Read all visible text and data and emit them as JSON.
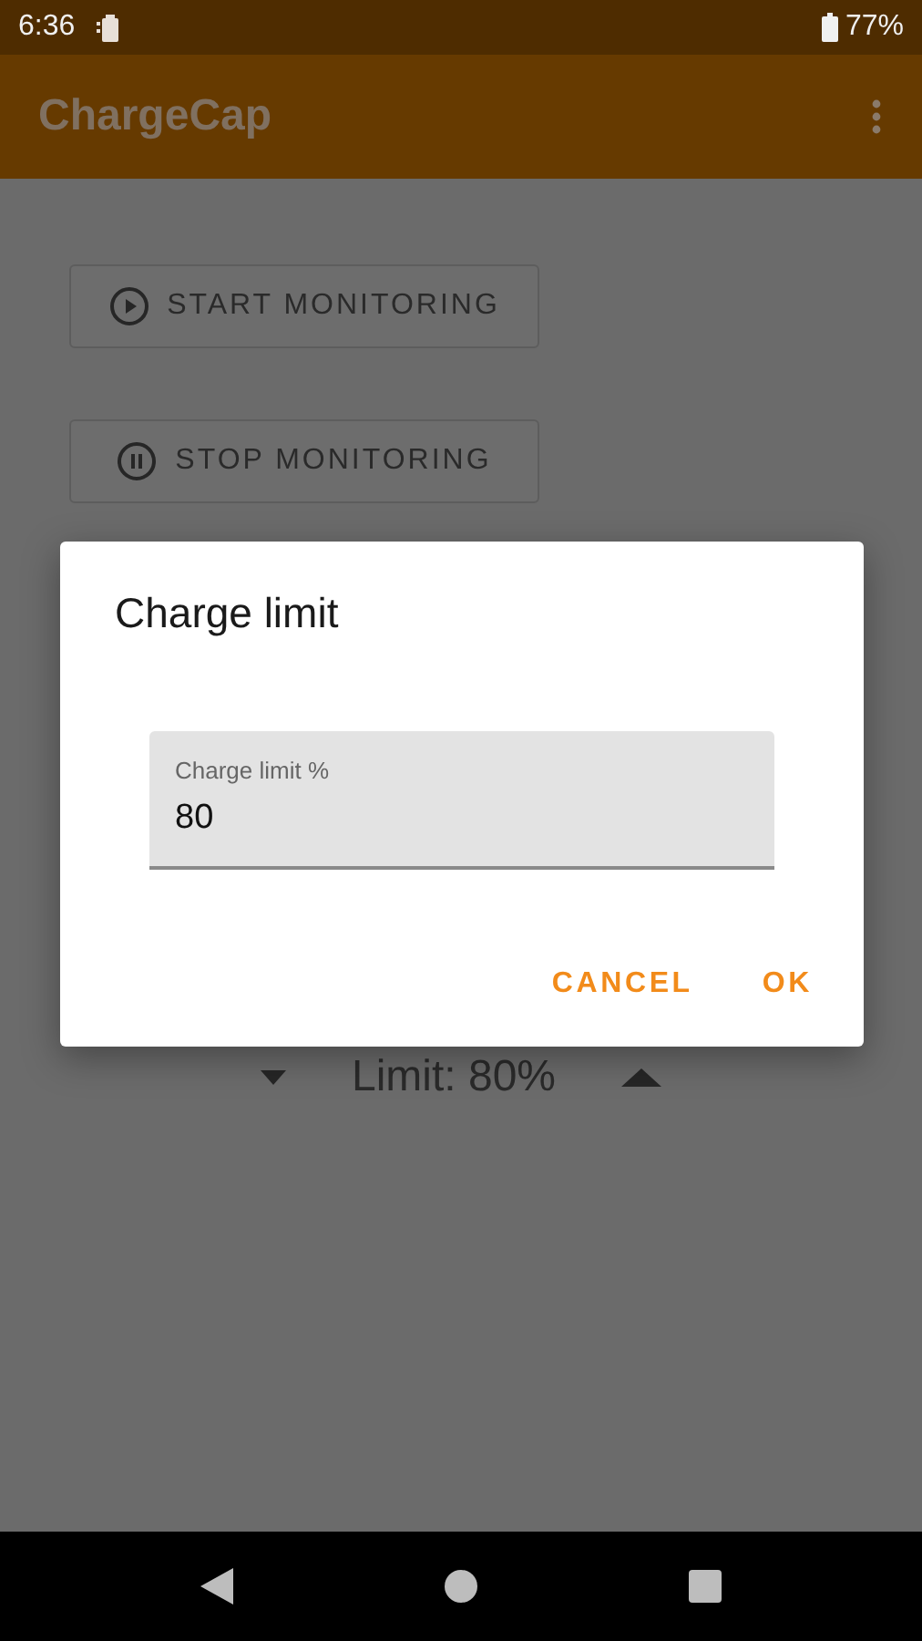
{
  "status_bar": {
    "time": "6:36",
    "battery": "77%"
  },
  "app_bar": {
    "title": "ChargeCap"
  },
  "buttons": [
    {
      "label": "START MONITORING",
      "kind": "play"
    },
    {
      "label": "STOP MONITORING",
      "kind": "pause"
    }
  ],
  "limit": {
    "text": "Limit: 80%"
  },
  "dialog": {
    "title": "Charge limit",
    "field": {
      "label": "Charge limit %",
      "value": "80"
    },
    "actions": [
      "CANCEL",
      "OK"
    ]
  }
}
